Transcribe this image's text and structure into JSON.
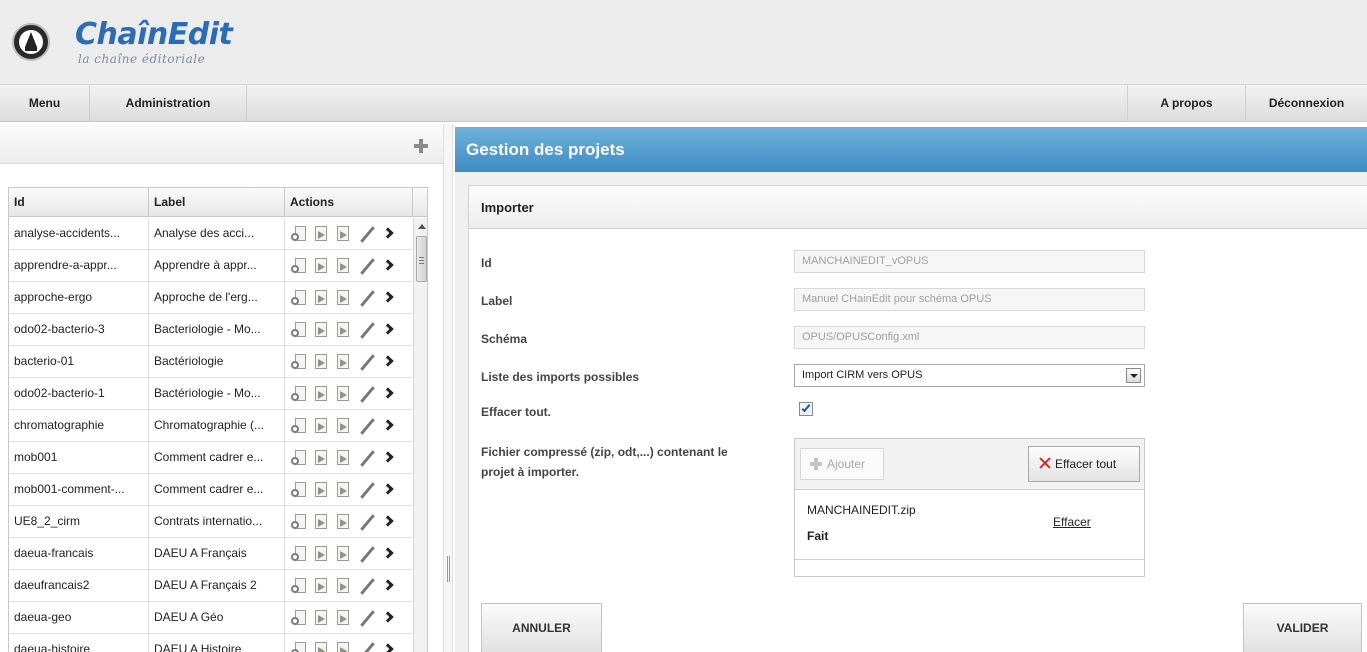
{
  "app": {
    "title": "ChaînEdit",
    "subtitle": "la chaîne éditoriale"
  },
  "menu": {
    "left": [
      "Menu",
      "Administration"
    ],
    "right": [
      "A propos",
      "Déconnexion"
    ]
  },
  "projects": {
    "columns": [
      "Id",
      "Label",
      "Actions"
    ],
    "rows": [
      {
        "id": "analyse-accidents...",
        "label": "Analyse des acci..."
      },
      {
        "id": "apprendre-a-appr...",
        "label": "Apprendre à appr..."
      },
      {
        "id": "approche-ergo",
        "label": "Approche de l'erg..."
      },
      {
        "id": "odo02-bacterio-3",
        "label": "Bacteriologie - Mo..."
      },
      {
        "id": "bacterio-01",
        "label": "Bactériologie"
      },
      {
        "id": "odo02-bacterio-1",
        "label": "Bactériologie - Mo..."
      },
      {
        "id": "chromatographie",
        "label": "Chromatographie (..."
      },
      {
        "id": "mob001",
        "label": "Comment cadrer e..."
      },
      {
        "id": "mob001-comment-...",
        "label": "Comment cadrer e..."
      },
      {
        "id": "UE8_2_cirm",
        "label": "Contrats internatio..."
      },
      {
        "id": "daeua-francais",
        "label": "DAEU A Français"
      },
      {
        "id": "daeufrancais2",
        "label": "DAEU A Français 2"
      },
      {
        "id": "daeua-geo",
        "label": "DAEU A Géo"
      },
      {
        "id": "daeua-histoire",
        "label": "DAEU A Histoire"
      }
    ],
    "action_icons": [
      "search-icon",
      "export-icon",
      "import-icon",
      "edit-icon",
      "more-icon"
    ]
  },
  "panel": {
    "title": "Gestion des projets",
    "section": "Importer"
  },
  "form": {
    "id_label": "Id",
    "id_value": "MANCHAINEDIT_vOPUS",
    "label_label": "Label",
    "label_value": "Manuel CHainEdit pour schéma OPUS",
    "schema_label": "Schéma",
    "schema_value": "OPUS/OPUSConfig.xml",
    "imports_label": "Liste des imports possibles",
    "imports_value": "Import CIRM vers OPUS",
    "clear_label": "Effacer tout.",
    "clear_checked": true,
    "file_label_1": "Fichier compressé (zip, odt,...) contenant le",
    "file_label_2": "projet à importer."
  },
  "upload": {
    "add_label": "Ajouter",
    "clear_all_label": "Effacer tout",
    "file_name": "MANCHAINEDIT.zip",
    "file_status": "Fait",
    "file_remove": "Effacer"
  },
  "buttons": {
    "cancel": "ANNULER",
    "submit": "VALIDER"
  },
  "colors": {
    "brand_blue": "#2b6cb7",
    "panel_blue": "#4f9dd0",
    "danger_red": "#d42a1f"
  }
}
